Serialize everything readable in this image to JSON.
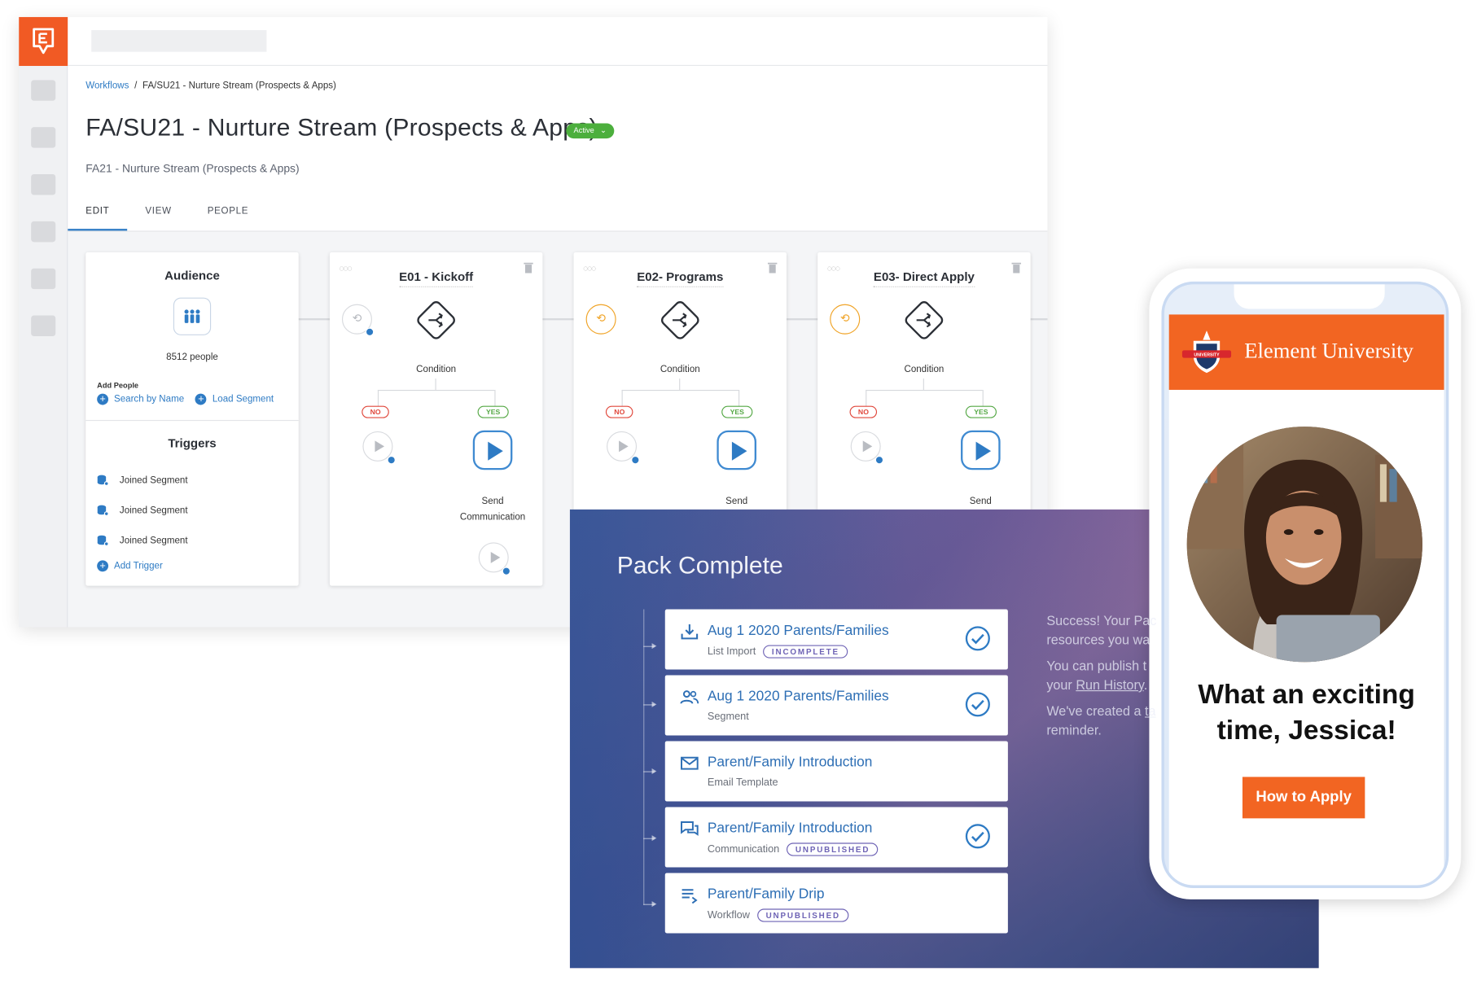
{
  "breadcrumb": {
    "root": "Workflows",
    "separator": "/",
    "current": "FA/SU21 - Nurture Stream (Prospects & Apps)"
  },
  "page": {
    "title": "FA/SU21 - Nurture Stream (Prospects & Apps)",
    "status": "Active",
    "subtitle": "FA21 - Nurture Stream (Prospects & Apps)"
  },
  "tabs": [
    {
      "label": "EDIT",
      "active": true
    },
    {
      "label": "VIEW"
    },
    {
      "label": "PEOPLE"
    }
  ],
  "audience": {
    "title": "Audience",
    "count": "8512 people",
    "add_people_label": "Add People",
    "search_by_name": "Search by Name",
    "load_segment": "Load Segment",
    "triggers_title": "Triggers",
    "triggers": [
      "Joined Segment",
      "Joined Segment",
      "Joined Segment"
    ],
    "add_trigger": "Add Trigger"
  },
  "steps": [
    {
      "title": "E01 - Kickoff",
      "condition": "Condition",
      "no": "NO",
      "yes": "YES",
      "send": "Send Communication"
    },
    {
      "title": "E02- Programs",
      "condition": "Condition",
      "no": "NO",
      "yes": "YES",
      "send": "Send"
    },
    {
      "title": "E03- Direct Apply",
      "condition": "Condition",
      "no": "NO",
      "yes": "YES",
      "send": "Send"
    }
  ],
  "pack": {
    "title": "Pack Complete",
    "items": [
      {
        "title": "Aug 1 2020 Parents/Families",
        "type": "List Import",
        "badge": "INCOMPLETE",
        "icon": "download-icon",
        "checked": true
      },
      {
        "title": "Aug 1 2020 Parents/Families",
        "type": "Segment",
        "badge": "",
        "icon": "people-icon",
        "checked": true
      },
      {
        "title": "Parent/Family Introduction",
        "type": "Email Template",
        "badge": "",
        "icon": "envelope-icon",
        "checked": false
      },
      {
        "title": "Parent/Family Introduction",
        "type": "Communication",
        "badge": "UNPUBLISHED",
        "icon": "chat-icon",
        "checked": true
      },
      {
        "title": "Parent/Family Drip",
        "type": "Workflow",
        "badge": "UNPUBLISHED",
        "icon": "list-icon",
        "checked": false
      }
    ],
    "side_text": {
      "p1": "Success! Your Pac resources you wa",
      "p2_prefix": "You can publish t your ",
      "p2_link": "Run History",
      "p2_suffix": ".",
      "p3_prefix": "We've created a ",
      "p3_link": "ta",
      "p3_suffix": " reminder."
    }
  },
  "phone": {
    "brand": "Element University",
    "crest_text": "UNIVERSITY",
    "greeting_line1": "What an exciting",
    "greeting_line2": "time, Jessica!",
    "cta": "How to Apply"
  },
  "colors": {
    "brand_orange": "#f15a24",
    "link_blue": "#2e7bc4",
    "active_green": "#4caf3d",
    "badge_purple": "#6e63b5"
  }
}
